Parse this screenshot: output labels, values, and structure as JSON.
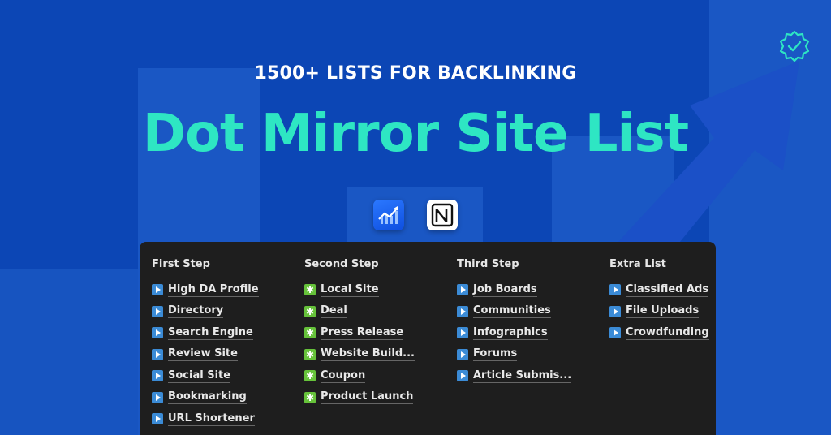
{
  "header": {
    "subtitle": "1500+ LISTS FOR BACKLINKING",
    "title": "Dot Mirror Site List"
  },
  "icons": {
    "badge": "verified-badge-icon",
    "logo_left": "chart-growth-logo-icon",
    "logo_right": "notion-logo-icon"
  },
  "colors": {
    "background": "#0c46b5",
    "title": "#2ee6c3",
    "panel": "#1e1e1e",
    "play_icon": "#3b8bd6",
    "star_icon": "#66c23a"
  },
  "columns": [
    {
      "heading": "First Step",
      "icon": "play",
      "items": [
        "High DA Profile",
        "Directory",
        "Search Engine",
        "Review Site",
        "Social Site",
        "Bookmarking",
        "URL Shortener"
      ]
    },
    {
      "heading": "Second Step",
      "icon": "star",
      "items": [
        "Local Site",
        "Deal",
        "Press Release",
        "Website Build...",
        "Coupon",
        "Product Launch"
      ]
    },
    {
      "heading": "Third Step",
      "icon": "play",
      "items": [
        "Job Boards",
        "Communities",
        "Infographics",
        "Forums",
        "Article Submis..."
      ]
    },
    {
      "heading": "Extra List",
      "icon": "play",
      "items": [
        "Classified Ads",
        "File Uploads",
        "Crowdfunding"
      ]
    }
  ]
}
